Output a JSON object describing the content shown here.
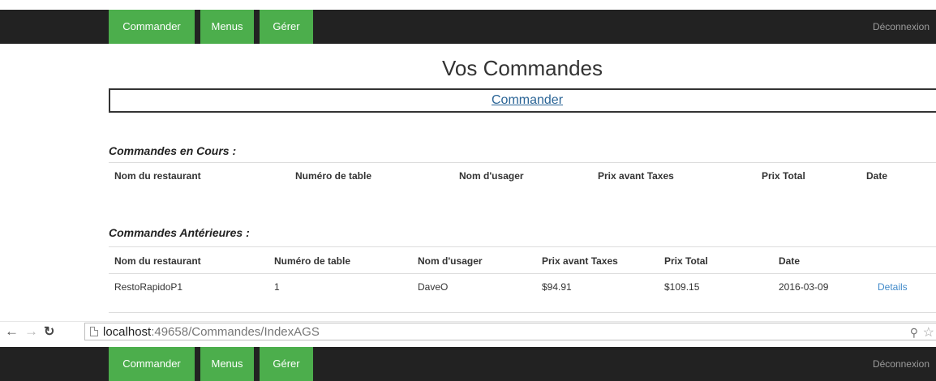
{
  "nav": {
    "items": [
      "Commander",
      "Menus",
      "Gérer"
    ],
    "logout": "Déconnexion"
  },
  "page": {
    "title": "Vos Commandes",
    "command_link": "Commander"
  },
  "current_orders": {
    "title": "Commandes en Cours :",
    "headers": [
      "Nom du restaurant",
      "Numéro de table",
      "Nom d'usager",
      "Prix avant Taxes",
      "Prix Total",
      "Date"
    ]
  },
  "past_orders": {
    "title": "Commandes Antérieures :",
    "headers": [
      "Nom du restaurant",
      "Numéro de table",
      "Nom d'usager",
      "Prix avant Taxes",
      "Prix Total",
      "Date"
    ],
    "rows": [
      {
        "restaurant": "RestoRapidoP1",
        "table": "1",
        "user": "DaveO",
        "price_before_tax": "$94.91",
        "total": "$109.15",
        "date": "2016-03-09",
        "details": "Details"
      }
    ]
  },
  "browser": {
    "url_host": "localhost",
    "url_rest": ":49658/Commandes/IndexAGS"
  },
  "icons": {
    "back": "back-arrow-icon",
    "forward": "forward-arrow-icon",
    "reload": "reload-icon",
    "page": "page-icon",
    "zoom": "zoom-icon",
    "bookmark": "star-icon"
  },
  "colors": {
    "navbar": "#222222",
    "nav_button": "#4cae4c",
    "link": "#428bca"
  }
}
